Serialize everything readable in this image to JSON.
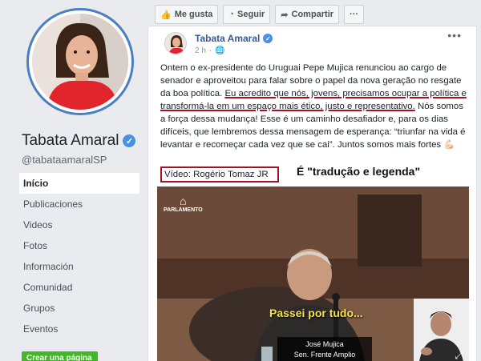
{
  "profile": {
    "name": "Tabata Amaral",
    "handle": "@tabataamaralSP"
  },
  "sidebar": {
    "items": [
      {
        "label": "Início",
        "active": true
      },
      {
        "label": "Publicaciones",
        "active": false
      },
      {
        "label": "Videos",
        "active": false
      },
      {
        "label": "Fotos",
        "active": false
      },
      {
        "label": "Información",
        "active": false
      },
      {
        "label": "Comunidad",
        "active": false
      },
      {
        "label": "Grupos",
        "active": false
      },
      {
        "label": "Eventos",
        "active": false
      }
    ],
    "create_page": "Crear una página"
  },
  "actions": {
    "like": "Me gusta",
    "follow": "Seguir",
    "share": "Compartir",
    "more": "···"
  },
  "post": {
    "author": "Tabata Amaral",
    "time": "2 h",
    "privacy_icon": "globe-icon",
    "text_1": "Ontem o ex-presidente do Uruguai Pepe Mujica renunciou ao cargo de senador e aproveitou para falar sobre o papel da nova geração no resgate da boa política.",
    "text_hl": "Eu acredito que nós, jovens, precisamos ocupar a política e transformá-la em um espaço mais ético, justo e representativo.",
    "text_2": "Nós somos a força dessa mudança! Esse é um caminho desafiador e, para os dias difíceis, que lembremos dessa mensagem de esperança: “triunfar na vida é levantar e recomeçar cada vez que se cai”. Juntos somos mais fortes 💪🏻",
    "video_credit": "Vídeo: Rogério Tomaz JR",
    "annotation": "É \"tradução e legenda\""
  },
  "video": {
    "logo": "PARLAMENTO",
    "subtitle": "Passei por tudo...",
    "lower_third_name": "José Mujica",
    "lower_third_title": "Sen. Frente Amplio"
  },
  "colors": {
    "brand": "#4267b2",
    "highlight_red": "#a31220",
    "verified": "#4a90e2",
    "create_green": "#42b72a"
  }
}
